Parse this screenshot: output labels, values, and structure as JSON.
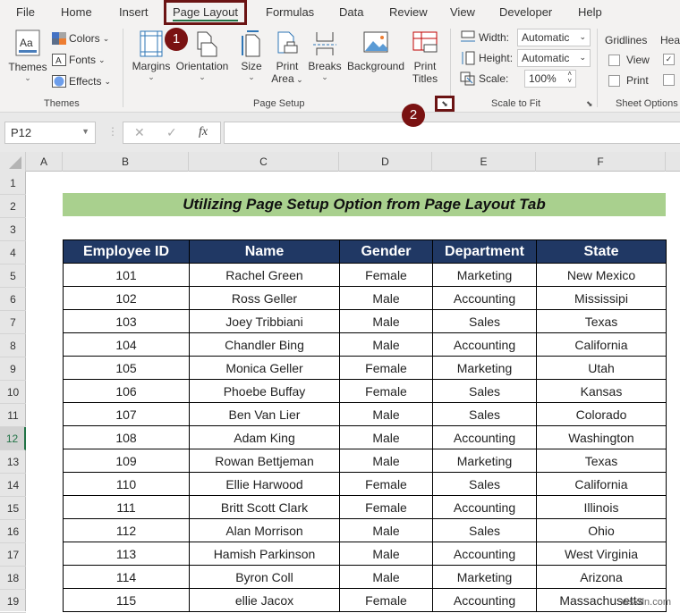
{
  "menu": {
    "tabs": [
      "File",
      "Home",
      "Insert",
      "Page Layout",
      "Formulas",
      "Data",
      "Review",
      "View",
      "Developer",
      "Help"
    ],
    "active_tab": "Page Layout"
  },
  "ribbon": {
    "themes_group": {
      "label": "Themes",
      "themes_btn": "Themes",
      "colors": "Colors",
      "fonts": "Fonts",
      "effects": "Effects"
    },
    "page_setup_group": {
      "label": "Page Setup",
      "margins": "Margins",
      "orientation": "Orientation",
      "size": "Size",
      "print_area_1": "Print",
      "print_area_2": "Area",
      "breaks": "Breaks",
      "background": "Background",
      "print_titles_1": "Print",
      "print_titles_2": "Titles"
    },
    "scale_group": {
      "label": "Scale to Fit",
      "width_label": "Width:",
      "width_value": "Automatic",
      "height_label": "Height:",
      "height_value": "Automatic",
      "scale_label": "Scale:",
      "scale_value": "100%"
    },
    "sheet_options_group": {
      "label": "Sheet Options",
      "gridlines": "Gridlines",
      "headings": "Hea",
      "view": "View",
      "print": "Print",
      "gridlines_view_checked": false,
      "gridlines_print_checked": false,
      "headings_view_checked": true,
      "headings_print_checked": false
    }
  },
  "badges": {
    "one": "1",
    "two": "2"
  },
  "formula_bar": {
    "name_box": "P12",
    "cancel": "✕",
    "enter": "✓",
    "fx": "fx",
    "formula": ""
  },
  "columns": [
    "A",
    "B",
    "C",
    "D",
    "E",
    "F"
  ],
  "rows": [
    "1",
    "2",
    "3",
    "4",
    "5",
    "6",
    "7",
    "8",
    "9",
    "10",
    "11",
    "12",
    "13",
    "14",
    "15",
    "16",
    "17",
    "18",
    "19"
  ],
  "selected_row": "12",
  "sheet": {
    "title": "Utilizing Page Setup Option from Page Layout Tab",
    "headers": [
      "Employee ID",
      "Name",
      "Gender",
      "Department",
      "State"
    ],
    "rows": [
      [
        "101",
        "Rachel Green",
        "Female",
        "Marketing",
        "New Mexico"
      ],
      [
        "102",
        "Ross Geller",
        "Male",
        "Accounting",
        "Mississipi"
      ],
      [
        "103",
        "Joey Tribbiani",
        "Male",
        "Sales",
        "Texas"
      ],
      [
        "104",
        "Chandler Bing",
        "Male",
        "Accounting",
        "California"
      ],
      [
        "105",
        "Monica Geller",
        "Female",
        "Marketing",
        "Utah"
      ],
      [
        "106",
        "Phoebe Buffay",
        "Female",
        "Sales",
        "Kansas"
      ],
      [
        "107",
        "Ben Van Lier",
        "Male",
        "Sales",
        "Colorado"
      ],
      [
        "108",
        "Adam King",
        "Male",
        "Accounting",
        "Washington"
      ],
      [
        "109",
        "Rowan Bettjeman",
        "Male",
        "Marketing",
        "Texas"
      ],
      [
        "110",
        "Ellie Harwood",
        "Female",
        "Sales",
        "California"
      ],
      [
        "111",
        "Britt Scott Clark",
        "Female",
        "Accounting",
        "Illinois"
      ],
      [
        "112",
        "Alan Morrison",
        "Male",
        "Sales",
        "Ohio"
      ],
      [
        "113",
        "Hamish Parkinson",
        "Male",
        "Accounting",
        "West Virginia"
      ],
      [
        "114",
        "Byron Coll",
        "Male",
        "Marketing",
        "Arizona"
      ],
      [
        "115",
        "ellie Jacox",
        "Female",
        "Accounting",
        "Massachusetts"
      ]
    ]
  },
  "watermark": "wsxdn.com",
  "colors": {
    "header_bg": "#203864",
    "title_bg": "#a9d08e",
    "highlight": "#6b1414",
    "badge": "#7a1212",
    "excel_green": "#217346"
  }
}
